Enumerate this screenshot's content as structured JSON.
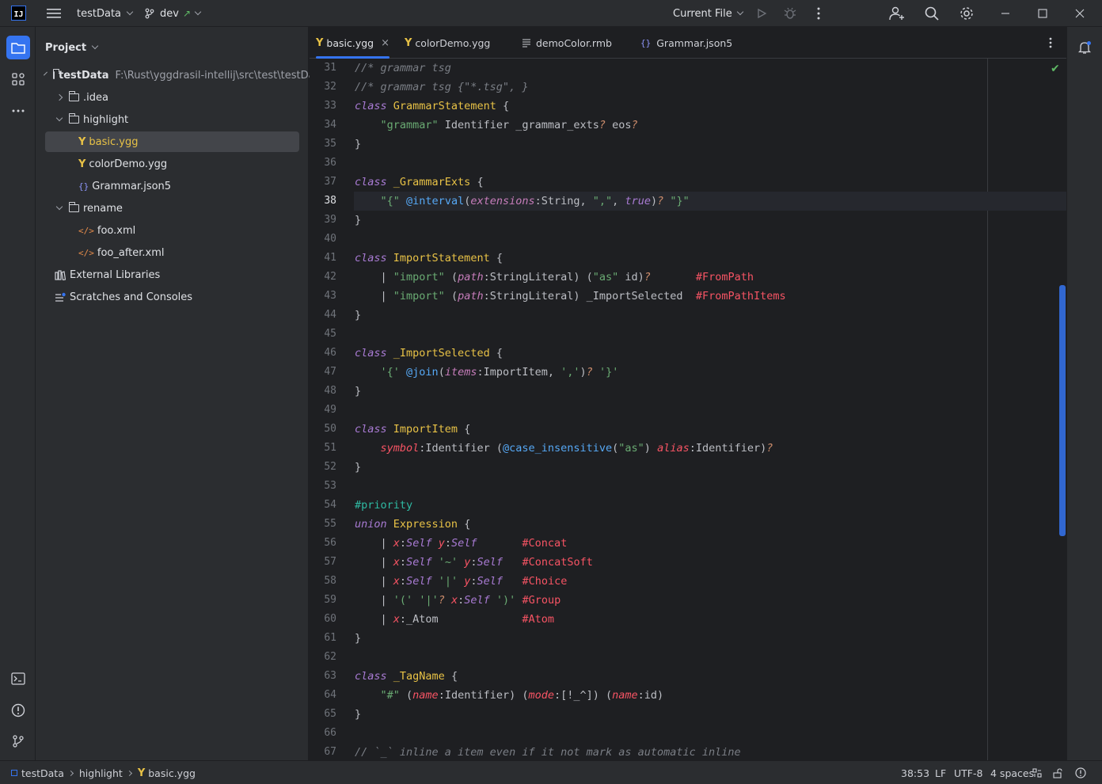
{
  "titlebar": {
    "logo": "IJ",
    "project_name": "testData",
    "branch": "dev",
    "branch_arrow": "↗",
    "run_config": "Current File"
  },
  "project_panel": {
    "title": "Project",
    "tree": [
      {
        "label": "testData",
        "path": "F:\\Rust\\yggdrasil-intellij\\src\\test\\testData",
        "kind": "root",
        "depth": 0,
        "expanded": true
      },
      {
        "label": ".idea",
        "kind": "folder",
        "depth": 1,
        "expanded": false
      },
      {
        "label": "highlight",
        "kind": "folder",
        "depth": 1,
        "expanded": true
      },
      {
        "label": "basic.ygg",
        "kind": "ygg",
        "depth": 2,
        "selected": true
      },
      {
        "label": "colorDemo.ygg",
        "kind": "ygg",
        "depth": 2
      },
      {
        "label": "Grammar.json5",
        "kind": "json",
        "depth": 2
      },
      {
        "label": "rename",
        "kind": "folder",
        "depth": 1,
        "expanded": true
      },
      {
        "label": "foo.xml",
        "kind": "xml",
        "depth": 2
      },
      {
        "label": "foo_after.xml",
        "kind": "xml",
        "depth": 2
      },
      {
        "label": "External Libraries",
        "kind": "libraries",
        "depth": 0
      },
      {
        "label": "Scratches and Consoles",
        "kind": "scratches",
        "depth": 0
      }
    ]
  },
  "tabs": [
    {
      "label": "basic.ygg",
      "kind": "ygg",
      "active": true
    },
    {
      "label": "colorDemo.ygg",
      "kind": "ygg"
    },
    {
      "label": "demoColor.rmb",
      "kind": "text"
    },
    {
      "label": "Grammar.json5",
      "kind": "json"
    }
  ],
  "editor": {
    "current_line": 38,
    "lines": [
      {
        "n": "31",
        "tokens": [
          [
            "c-cm",
            "//* grammar tsg"
          ]
        ]
      },
      {
        "n": "32",
        "tokens": [
          [
            "c-cm",
            "//* grammar tsg {\"*.tsg\", }"
          ]
        ]
      },
      {
        "n": "33",
        "tokens": [
          [
            "c-kw2",
            "class"
          ],
          [
            "",
            " "
          ],
          [
            "c-cls",
            "GrammarStatement"
          ],
          [
            "",
            " {"
          ]
        ]
      },
      {
        "n": "34",
        "tokens": [
          [
            "",
            "    "
          ],
          [
            "c-str",
            "\"grammar\""
          ],
          [
            "",
            " Identifier _grammar_exts"
          ],
          [
            "c-op",
            "?"
          ],
          [
            "",
            " eos"
          ],
          [
            "c-op",
            "?"
          ]
        ]
      },
      {
        "n": "35",
        "tokens": [
          [
            "",
            "}"
          ]
        ]
      },
      {
        "n": "36",
        "tokens": []
      },
      {
        "n": "37",
        "tokens": [
          [
            "c-kw2",
            "class"
          ],
          [
            "",
            " "
          ],
          [
            "c-cls",
            "_GrammarExts"
          ],
          [
            "",
            " {"
          ]
        ]
      },
      {
        "n": "38",
        "tokens": [
          [
            "",
            "    "
          ],
          [
            "c-str",
            "\"{\""
          ],
          [
            "",
            " "
          ],
          [
            "c-mac",
            "@interval"
          ],
          [
            "",
            "("
          ],
          [
            "c-fld",
            "extensions"
          ],
          [
            "",
            ":String, "
          ],
          [
            "c-str",
            "\",\""
          ],
          [
            "",
            ", "
          ],
          [
            "c-kw2",
            "true"
          ],
          [
            "",
            ")"
          ],
          [
            "c-op",
            "?"
          ],
          [
            "",
            " "
          ],
          [
            "c-str",
            "\"}\""
          ]
        ]
      },
      {
        "n": "39",
        "tokens": [
          [
            "",
            "}"
          ]
        ]
      },
      {
        "n": "40",
        "tokens": []
      },
      {
        "n": "41",
        "tokens": [
          [
            "c-kw2",
            "class"
          ],
          [
            "",
            " "
          ],
          [
            "c-cls",
            "ImportStatement"
          ],
          [
            "",
            " {"
          ]
        ]
      },
      {
        "n": "42",
        "tokens": [
          [
            "",
            "    | "
          ],
          [
            "c-str",
            "\"import\""
          ],
          [
            "",
            " ("
          ],
          [
            "c-fld",
            "path"
          ],
          [
            "",
            ":StringLiteral) ("
          ],
          [
            "c-str",
            "\"as\""
          ],
          [
            "",
            " id)"
          ],
          [
            "c-op",
            "?"
          ],
          [
            "",
            "       "
          ],
          [
            "c-tag",
            "#FromPath"
          ]
        ]
      },
      {
        "n": "43",
        "tokens": [
          [
            "",
            "    | "
          ],
          [
            "c-str",
            "\"import\""
          ],
          [
            "",
            " ("
          ],
          [
            "c-fld",
            "path"
          ],
          [
            "",
            ":StringLiteral) _ImportSelected  "
          ],
          [
            "c-tag",
            "#FromPathItems"
          ]
        ]
      },
      {
        "n": "44",
        "tokens": [
          [
            "",
            "}"
          ]
        ]
      },
      {
        "n": "45",
        "tokens": []
      },
      {
        "n": "46",
        "tokens": [
          [
            "c-kw2",
            "class"
          ],
          [
            "",
            " "
          ],
          [
            "c-cls",
            "_ImportSelected"
          ],
          [
            "",
            " {"
          ]
        ]
      },
      {
        "n": "47",
        "tokens": [
          [
            "",
            "    "
          ],
          [
            "c-str",
            "'{'"
          ],
          [
            "",
            " "
          ],
          [
            "c-mac",
            "@join"
          ],
          [
            "",
            "("
          ],
          [
            "c-fld",
            "items"
          ],
          [
            "",
            ":ImportItem, "
          ],
          [
            "c-str",
            "','"
          ],
          [
            "",
            ")"
          ],
          [
            "c-op",
            "?"
          ],
          [
            "",
            " "
          ],
          [
            "c-str",
            "'}'"
          ]
        ]
      },
      {
        "n": "48",
        "tokens": [
          [
            "",
            "}"
          ]
        ]
      },
      {
        "n": "49",
        "tokens": []
      },
      {
        "n": "50",
        "tokens": [
          [
            "c-kw2",
            "class"
          ],
          [
            "",
            " "
          ],
          [
            "c-cls",
            "ImportItem"
          ],
          [
            "",
            " {"
          ]
        ]
      },
      {
        "n": "51",
        "tokens": [
          [
            "",
            "    "
          ],
          [
            "c-red",
            "symbol"
          ],
          [
            "",
            ":Identifier ("
          ],
          [
            "c-mac",
            "@case_insensitive"
          ],
          [
            "",
            "("
          ],
          [
            "c-str",
            "\"as\""
          ],
          [
            "",
            ") "
          ],
          [
            "c-red",
            "alias"
          ],
          [
            "",
            ":Identifier)"
          ],
          [
            "c-op",
            "?"
          ]
        ]
      },
      {
        "n": "52",
        "tokens": [
          [
            "",
            "}"
          ]
        ]
      },
      {
        "n": "53",
        "tokens": []
      },
      {
        "n": "54",
        "tokens": [
          [
            "c-teal",
            "#priority"
          ]
        ]
      },
      {
        "n": "55",
        "tokens": [
          [
            "c-kw2",
            "union"
          ],
          [
            "",
            " "
          ],
          [
            "c-cls",
            "Expression"
          ],
          [
            "",
            " {"
          ]
        ]
      },
      {
        "n": "56",
        "tokens": [
          [
            "",
            "    | "
          ],
          [
            "c-red",
            "x"
          ],
          [
            "",
            ":"
          ],
          [
            "c-self",
            "Self"
          ],
          [
            "",
            " "
          ],
          [
            "c-red",
            "y"
          ],
          [
            "",
            ":"
          ],
          [
            "c-self",
            "Self"
          ],
          [
            "",
            "       "
          ],
          [
            "c-tag",
            "#Concat"
          ]
        ]
      },
      {
        "n": "57",
        "tokens": [
          [
            "",
            "    | "
          ],
          [
            "c-red",
            "x"
          ],
          [
            "",
            ":"
          ],
          [
            "c-self",
            "Self"
          ],
          [
            "",
            " "
          ],
          [
            "c-str",
            "'~'"
          ],
          [
            "",
            " "
          ],
          [
            "c-red",
            "y"
          ],
          [
            "",
            ":"
          ],
          [
            "c-self",
            "Self"
          ],
          [
            "",
            "   "
          ],
          [
            "c-tag",
            "#ConcatSoft"
          ]
        ]
      },
      {
        "n": "58",
        "tokens": [
          [
            "",
            "    | "
          ],
          [
            "c-red",
            "x"
          ],
          [
            "",
            ":"
          ],
          [
            "c-self",
            "Self"
          ],
          [
            "",
            " "
          ],
          [
            "c-str",
            "'|'"
          ],
          [
            "",
            " "
          ],
          [
            "c-red",
            "y"
          ],
          [
            "",
            ":"
          ],
          [
            "c-self",
            "Self"
          ],
          [
            "",
            "   "
          ],
          [
            "c-tag",
            "#Choice"
          ]
        ]
      },
      {
        "n": "59",
        "tokens": [
          [
            "",
            "    | "
          ],
          [
            "c-str",
            "'('"
          ],
          [
            "",
            " "
          ],
          [
            "c-str",
            "'|'"
          ],
          [
            "c-op",
            "?"
          ],
          [
            "",
            " "
          ],
          [
            "c-red",
            "x"
          ],
          [
            "",
            ":"
          ],
          [
            "c-self",
            "Self"
          ],
          [
            "",
            " "
          ],
          [
            "c-str",
            "')'"
          ],
          [
            "",
            " "
          ],
          [
            "c-tag",
            "#Group"
          ]
        ]
      },
      {
        "n": "60",
        "tokens": [
          [
            "",
            "    | "
          ],
          [
            "c-red",
            "x"
          ],
          [
            "",
            ":_Atom             "
          ],
          [
            "c-tag",
            "#Atom"
          ]
        ]
      },
      {
        "n": "61",
        "tokens": [
          [
            "",
            "}"
          ]
        ]
      },
      {
        "n": "62",
        "tokens": []
      },
      {
        "n": "63",
        "tokens": [
          [
            "c-kw2",
            "class"
          ],
          [
            "",
            " "
          ],
          [
            "c-cls",
            "_TagName"
          ],
          [
            "",
            " {"
          ]
        ]
      },
      {
        "n": "64",
        "tokens": [
          [
            "",
            "    "
          ],
          [
            "c-str",
            "\"#\""
          ],
          [
            "",
            " ("
          ],
          [
            "c-red",
            "name"
          ],
          [
            "",
            ":Identifier) ("
          ],
          [
            "c-red",
            "mode"
          ],
          [
            "",
            ":[!_^]) ("
          ],
          [
            "c-red",
            "name"
          ],
          [
            "",
            ":id)"
          ]
        ]
      },
      {
        "n": "65",
        "tokens": [
          [
            "",
            "}"
          ]
        ]
      },
      {
        "n": "66",
        "tokens": []
      },
      {
        "n": "67",
        "tokens": [
          [
            "c-cm",
            "// `_` inline a item even if it not mark as automatic inline"
          ]
        ]
      }
    ]
  },
  "statusbar": {
    "breadcrumb": [
      "testData",
      "highlight",
      "basic.ygg"
    ],
    "position": "38:53",
    "line_sep": "LF",
    "encoding": "UTF-8",
    "indent": "4 spaces"
  },
  "colors": {
    "accent": "#3574f0",
    "bg": "#1e1f22",
    "panel": "#2b2d30"
  }
}
